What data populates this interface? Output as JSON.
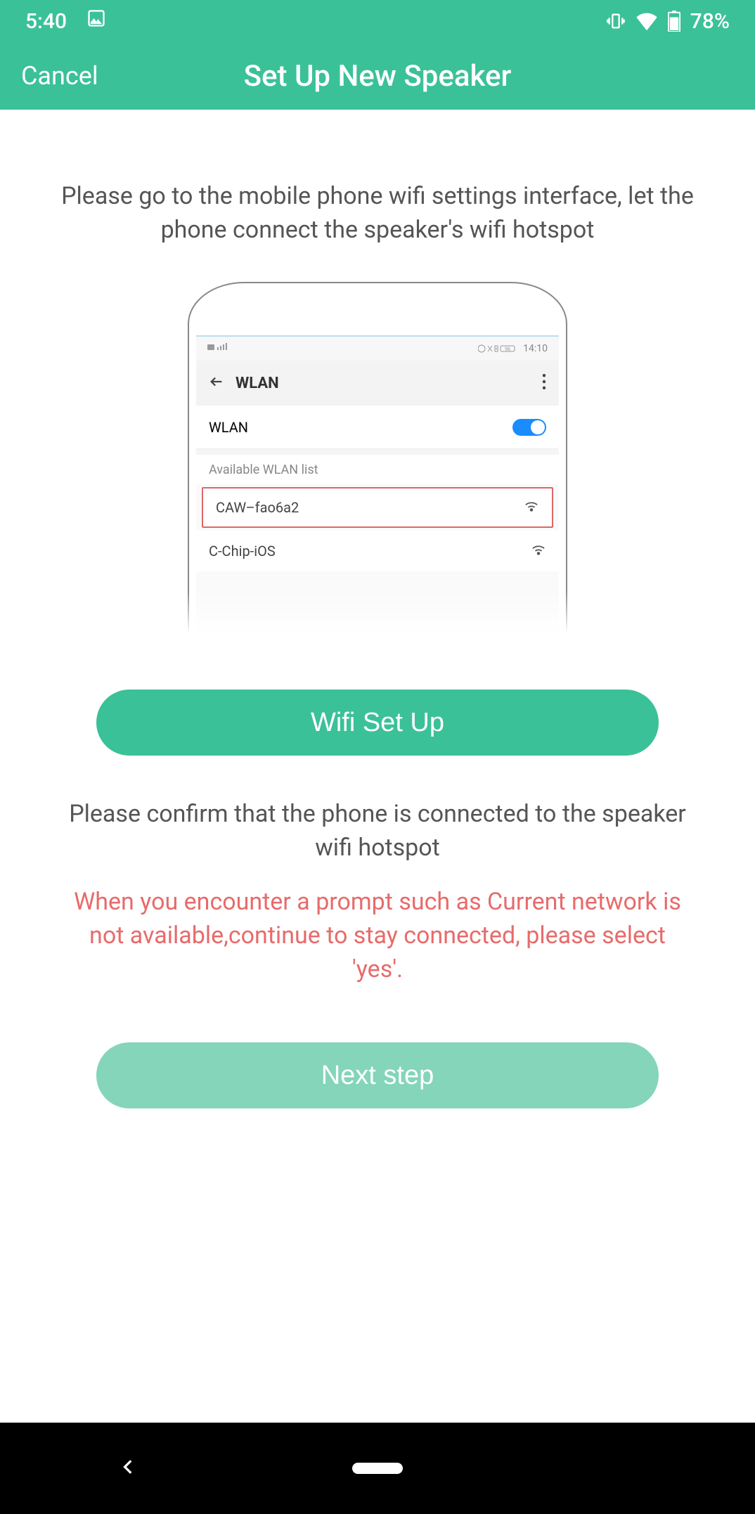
{
  "status": {
    "time": "5:40",
    "battery": "78%"
  },
  "header": {
    "cancel": "Cancel",
    "title": "Set Up New Speaker"
  },
  "main": {
    "instruction_top": "Please go to the mobile phone wifi settings interface, let the phone connect the speaker's wifi hotspot",
    "button_wifi_setup": "Wifi Set Up",
    "instruction_confirm": "Please confirm that the phone is connected to the speaker wifi hotspot",
    "warning_text": "When you encounter a prompt such as Current network is not available,continue to stay connected, please select 'yes'.",
    "button_next": "Next step"
  },
  "illustration": {
    "status_right": "14:10",
    "wlan_title": "WLAN",
    "wlan_row_label": "WLAN",
    "available_label": "Available WLAN list",
    "wifi_1": "CAW–fao6a2",
    "wifi_2": "C-Chip-iOS"
  }
}
